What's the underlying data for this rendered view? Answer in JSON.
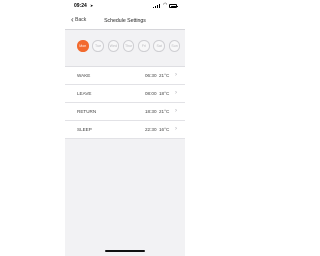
{
  "status_bar": {
    "time": "09:24",
    "location_glyph": "➤"
  },
  "nav": {
    "back_label": "Back",
    "title": "Schedule Settings"
  },
  "days": [
    {
      "label": "Mon",
      "active": true
    },
    {
      "label": "Tue",
      "active": false
    },
    {
      "label": "Wed",
      "active": false
    },
    {
      "label": "Thur",
      "active": false
    },
    {
      "label": "Fri",
      "active": false
    },
    {
      "label": "Sat",
      "active": false
    },
    {
      "label": "Sun",
      "active": false
    }
  ],
  "schedule": [
    {
      "label": "WAKE",
      "time": "06:30",
      "temp": "21°C"
    },
    {
      "label": "LEAVE",
      "time": "08:00",
      "temp": "18°C"
    },
    {
      "label": "RETURN",
      "time": "18:30",
      "temp": "21°C"
    },
    {
      "label": "SLEEP",
      "time": "22:30",
      "temp": "16°C"
    }
  ],
  "colors": {
    "accent": "#f26a2e",
    "background": "#f2f2f4",
    "row_bg": "#ffffff"
  },
  "icons": [
    "location-arrow-icon",
    "signal-icon",
    "wifi-icon",
    "battery-icon",
    "back-chevron-icon",
    "row-chevron-icon"
  ]
}
